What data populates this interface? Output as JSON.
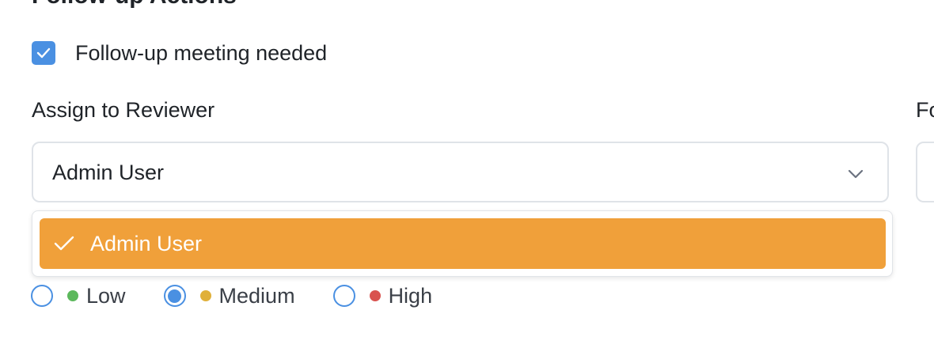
{
  "section": {
    "title": "Follow-up Actions"
  },
  "followup": {
    "checkbox_label": "Follow-up meeting needed",
    "checked": true
  },
  "reviewer": {
    "label": "Assign to Reviewer",
    "selected": "Admin User",
    "options": [
      {
        "label": "Admin User",
        "selected": true
      }
    ]
  },
  "right_field": {
    "label_partial": "Fo"
  },
  "priority": {
    "options": [
      {
        "label": "Low",
        "color": "#5cb85c",
        "checked": false
      },
      {
        "label": "Medium",
        "color": "#e0b03a",
        "checked": true
      },
      {
        "label": "High",
        "color": "#d9534f",
        "checked": false
      }
    ]
  },
  "colors": {
    "accent": "#4a90e2",
    "highlight": "#f0a03a"
  }
}
